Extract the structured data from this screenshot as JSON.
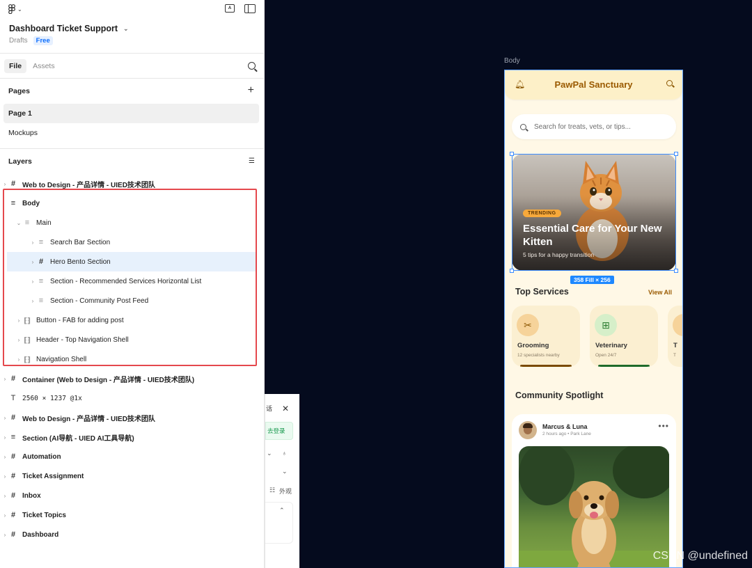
{
  "project": {
    "name": "Dashboard Ticket Support",
    "location": "Drafts",
    "plan": "Free"
  },
  "tabs": [
    {
      "label": "File"
    },
    {
      "label": "Assets"
    }
  ],
  "pages": {
    "heading": "Pages",
    "items": [
      {
        "label": "Page 1"
      },
      {
        "label": "Mockups"
      }
    ]
  },
  "layers": {
    "heading": "Layers",
    "items": [
      {
        "label": "Web to Design - 产品详情 - UIED技术团队"
      },
      {
        "label": "Body"
      },
      {
        "label": "Main"
      },
      {
        "label": "Search Bar Section"
      },
      {
        "label": "Hero Bento Section"
      },
      {
        "label": "Section - Recommended Services Horizontal List"
      },
      {
        "label": "Section - Community Post Feed"
      },
      {
        "label": "Button - FAB for adding post"
      },
      {
        "label": "Header - Top Navigation Shell"
      },
      {
        "label": "Navigation Shell"
      },
      {
        "label": "Container (Web to Design - 产品详情 - UIED技术团队)"
      },
      {
        "label": "2560 × 1237 @1x"
      },
      {
        "label": "Web to Design - 产品详情 - UIED技术团队"
      },
      {
        "label": "Section (AI导航 - UIED AI工具导航)"
      },
      {
        "label": "Automation"
      },
      {
        "label": "Ticket Assignment"
      },
      {
        "label": "Inbox"
      },
      {
        "label": "Ticket Topics"
      },
      {
        "label": "Dashboard"
      }
    ]
  },
  "popup": {
    "close": "✕",
    "text1": "话",
    "button": "去登录",
    "row_label": "外观"
  },
  "canvas": {
    "frame_label": "Body",
    "size_tag": "358 Fill × 256",
    "app": {
      "title": "PawPal Sanctuary",
      "search_placeholder": "Search for treats, vets, or tips...",
      "hero": {
        "badge": "TRENDING",
        "title": "Essential Care for Your New Kitten",
        "subtitle": "5 tips for a happy transition"
      },
      "services_title": "Top Services",
      "view_all": "View All",
      "services": [
        {
          "name": "Grooming",
          "desc": "12 specialists nearby",
          "color": "#f6d39a",
          "accent": "#8a5500",
          "bar": "#7a4a00"
        },
        {
          "name": "Veterinary",
          "desc": "Open 24/7",
          "color": "#d6efc9",
          "accent": "#2e7d32",
          "bar": "#1e6b2a"
        },
        {
          "name": "T",
          "desc": "T",
          "color": "#f6d39a",
          "accent": "#8a5500",
          "bar": "#7a4a00"
        }
      ],
      "community_title": "Community Spotlight",
      "post": {
        "author": "Marcus & Luna",
        "meta": "2 hours ago • Park Lane"
      }
    }
  },
  "watermark": "CSDN @undefined",
  "colors": {
    "accent_blue": "#0d6efd",
    "highlight_red": "#e5484d",
    "selection_blue": "#3b8cff",
    "brand_brown": "#9a5a00"
  }
}
